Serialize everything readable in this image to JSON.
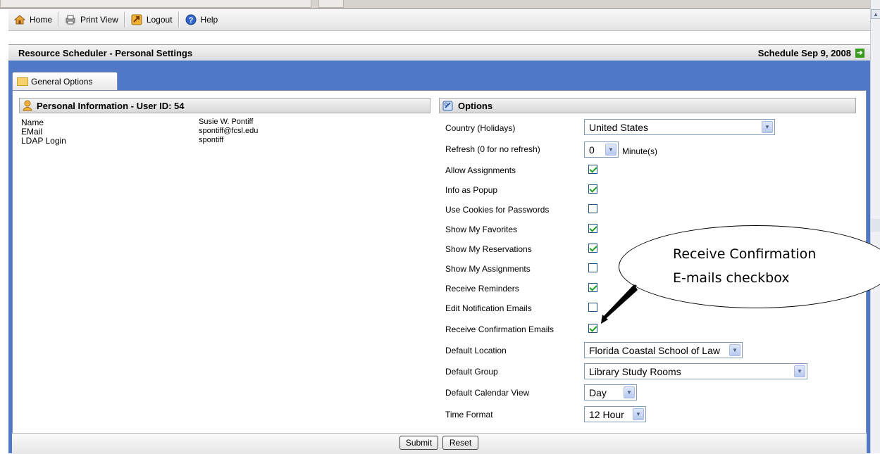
{
  "toolbar": {
    "items": [
      {
        "label": "Home",
        "icon": "home-icon"
      },
      {
        "label": "Print View",
        "icon": "printer-icon"
      },
      {
        "label": "Logout",
        "icon": "logout-icon"
      },
      {
        "label": "Help",
        "icon": "help-icon"
      }
    ]
  },
  "header": {
    "title": "Resource Scheduler - Personal Settings",
    "schedule_link": "Schedule Sep 9, 2008"
  },
  "tab": {
    "label": "General Options"
  },
  "personal": {
    "heading": "Personal Information - User ID: 54",
    "rows": [
      {
        "label": "Name",
        "value": "Susie W. Pontiff"
      },
      {
        "label": "EMail",
        "value": "spontiff@fcsl.edu"
      },
      {
        "label": "LDAP Login",
        "value": "spontiff"
      }
    ]
  },
  "options": {
    "heading": "Options",
    "country": {
      "label": "Country (Holidays)",
      "value": "United States"
    },
    "refresh": {
      "label": "Refresh (0 for no refresh)",
      "value": "0",
      "unit": "Minute(s)"
    },
    "checkboxes": [
      {
        "label": "Allow Assignments",
        "checked": true
      },
      {
        "label": "Info as Popup",
        "checked": true
      },
      {
        "label": "Use Cookies for Passwords",
        "checked": false
      },
      {
        "label": "Show My Favorites",
        "checked": true
      },
      {
        "label": "Show My Reservations",
        "checked": true
      },
      {
        "label": "Show My Assignments",
        "checked": false
      },
      {
        "label": "Receive Reminders",
        "checked": true
      },
      {
        "label": "Edit Notification Emails",
        "checked": false
      },
      {
        "label": "Receive Confirmation Emails",
        "checked": true
      }
    ],
    "default_location": {
      "label": "Default Location",
      "value": "Florida Coastal School of Law"
    },
    "default_group": {
      "label": "Default Group",
      "value": "Library Study Rooms"
    },
    "default_view": {
      "label": "Default Calendar View",
      "value": "Day"
    },
    "time_format": {
      "label": "Time Format",
      "value": "12 Hour"
    }
  },
  "buttons": {
    "submit": "Submit",
    "reset": "Reset"
  },
  "callout": {
    "line1": "Receive Confirmation",
    "line2": "E-mails checkbox"
  },
  "colors": {
    "frame_blue": "#4f79c6",
    "check_green": "#21a121"
  }
}
